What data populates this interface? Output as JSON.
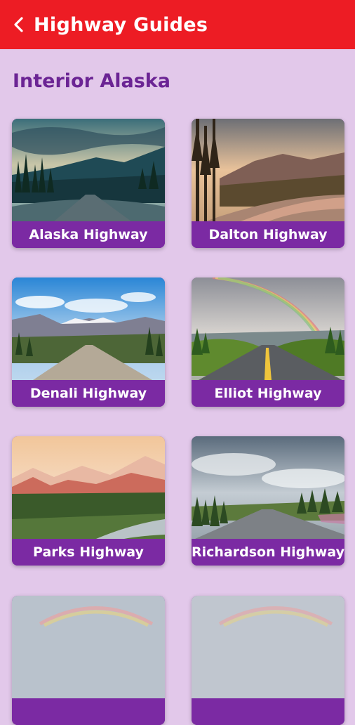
{
  "header": {
    "title": "Highway Guides",
    "back_icon": "chevron-left-icon",
    "background": "#ed1c24"
  },
  "section": {
    "title": "Interior Alaska"
  },
  "cards": [
    {
      "label": "Alaska Highway"
    },
    {
      "label": "Dalton Highway"
    },
    {
      "label": "Denali Highway"
    },
    {
      "label": "Elliot Highway"
    },
    {
      "label": "Parks Highway"
    },
    {
      "label": "Richardson Highway"
    },
    {
      "label": ""
    },
    {
      "label": ""
    }
  ],
  "colors": {
    "page_background": "#e2c8ea",
    "section_title": "#6b2494",
    "card_label_background": "#7b2aa3"
  }
}
